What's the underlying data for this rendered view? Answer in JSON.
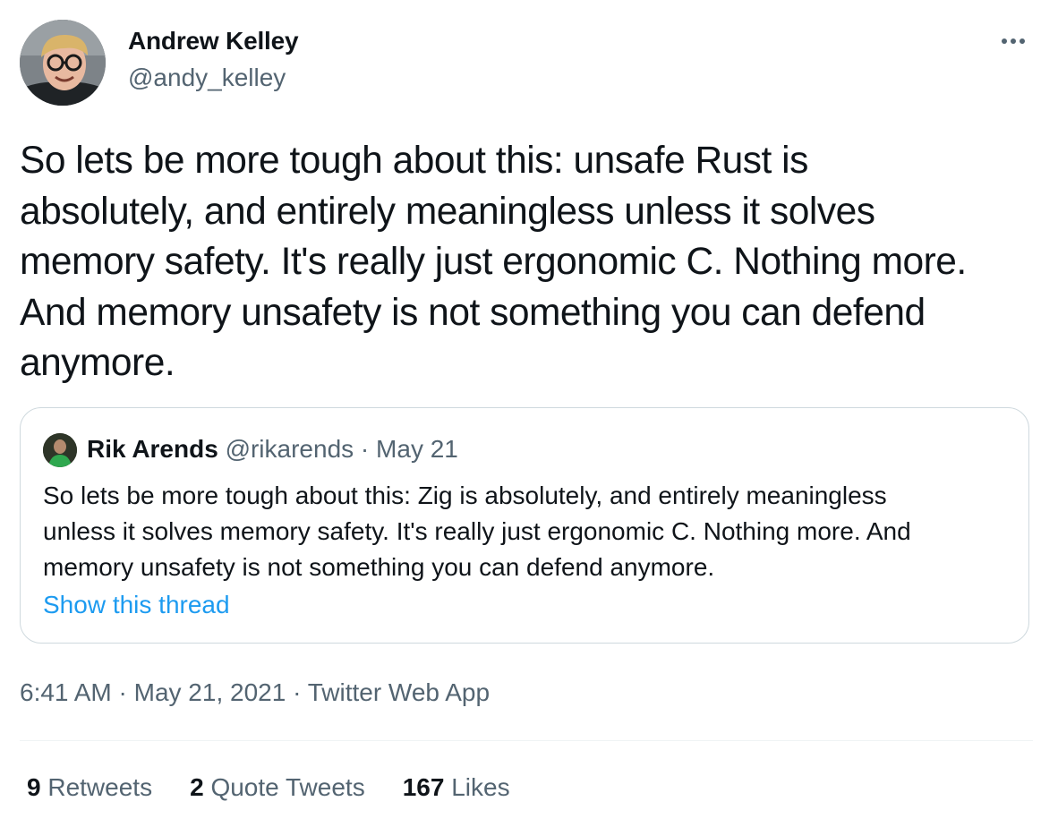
{
  "author": {
    "name": "Andrew Kelley",
    "handle": "@andy_kelley",
    "avatar_icon": "profile-photo-avatar"
  },
  "more_icon": "ellipsis-icon",
  "tweet": {
    "text": "So lets be more tough about this: unsafe Rust is\nabsolutely, and entirely meaningless unless it solves\nmemory safety. It's really just ergonomic C. Nothing more.\nAnd memory unsafety is not something you can defend\nanymore."
  },
  "quote": {
    "name": "Rik Arends",
    "handle": "@rikarends",
    "separator": " · ",
    "date": "May 21",
    "text": "So lets be more tough about this: Zig is absolutely, and entirely meaningless\nunless it solves memory safety. It's really just ergonomic C. Nothing more. And\nmemory unsafety is not something you can defend anymore.",
    "show_thread": "Show this thread"
  },
  "meta": {
    "time": "6:41 AM",
    "separator": " · ",
    "date": "May 21, 2021",
    "source": "Twitter Web App"
  },
  "stats": {
    "retweets_count": "9",
    "retweets_label": "Retweets",
    "quotes_count": "2",
    "quotes_label": "Quote Tweets",
    "likes_count": "167",
    "likes_label": "Likes"
  },
  "colors": {
    "text": "#0f1419",
    "secondary": "#536471",
    "link": "#1d9bf0",
    "border": "#cfd9de"
  }
}
